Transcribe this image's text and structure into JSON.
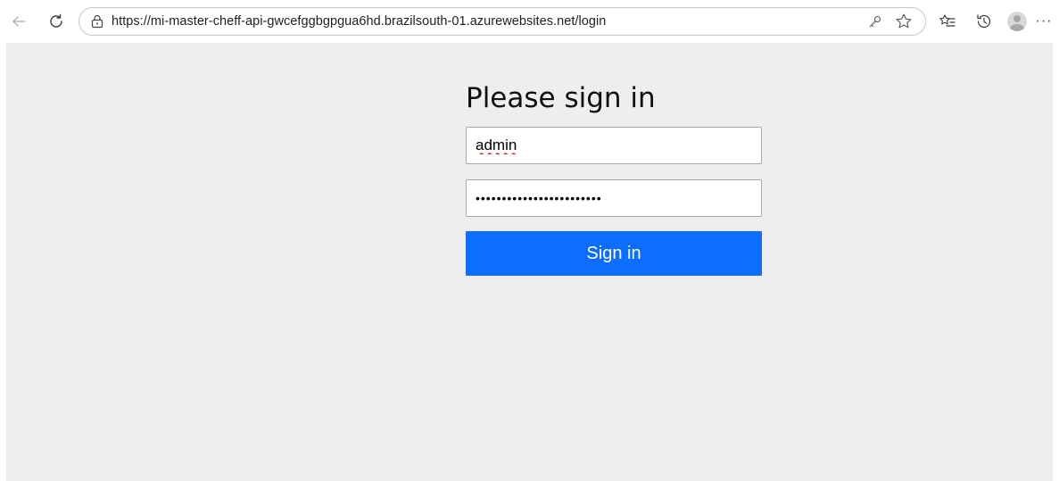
{
  "browser": {
    "url": "https://mi-master-cheff-api-gwcefggbgpgua6hd.brazilsouth-01.azurewebsites.net/login",
    "icons": {
      "back": "arrow-left-icon",
      "refresh": "refresh-icon",
      "site_info": "lock-icon",
      "passwords": "key-icon",
      "favorite": "star-icon",
      "favorites_bar": "favorites-icon",
      "history": "history-icon",
      "profile": "avatar",
      "more": "more-icon"
    },
    "more_label": "···"
  },
  "login_form": {
    "heading": "Please sign in",
    "username_value": "admin",
    "password_value": "••••••••••••••••••••••••",
    "submit_label": "Sign in"
  },
  "colors": {
    "page_background": "#eeeeee",
    "button_primary": "#0d6efd",
    "button_text": "#ffffff"
  }
}
